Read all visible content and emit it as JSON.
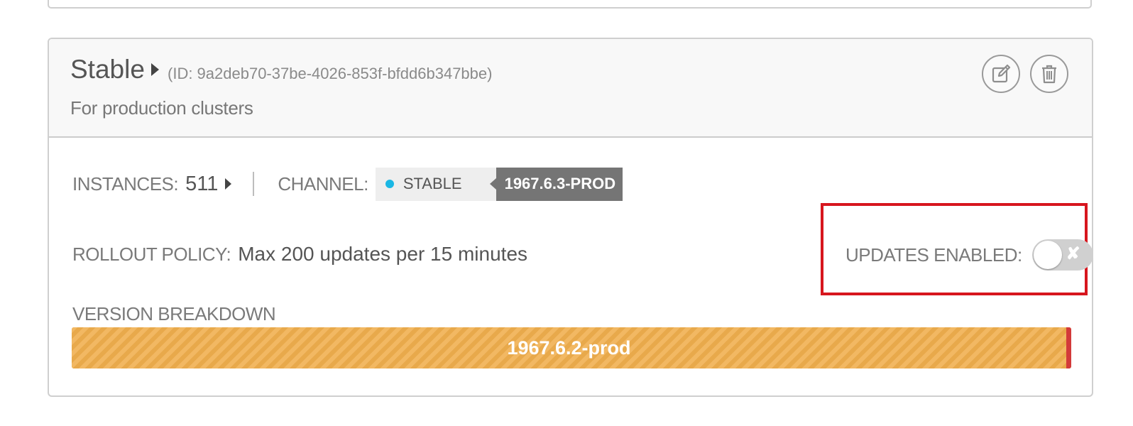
{
  "group": {
    "name": "Stable",
    "id_text": "(ID: 9a2deb70-37be-4026-853f-bfdd6b347bbe)",
    "description": "For production clusters"
  },
  "actions": {
    "edit_icon": "edit-icon",
    "delete_icon": "trash-icon"
  },
  "instances": {
    "label": "INSTANCES:",
    "value": "511"
  },
  "channel": {
    "label": "CHANNEL:",
    "name": "STABLE",
    "version": "1967.6.3-PROD",
    "dot_color": "#1ab7e4"
  },
  "rollout": {
    "label": "ROLLOUT POLICY:",
    "value": "Max 200 updates per 15 minutes"
  },
  "updates": {
    "label": "UPDATES ENABLED:",
    "enabled": false,
    "off_glyph": "✘"
  },
  "version_breakdown": {
    "label": "VERSION BREAKDOWN",
    "segments": [
      {
        "version": "1967.6.2-prod",
        "fraction": 0.995,
        "color": "#f0ae4d"
      },
      {
        "version": "",
        "fraction": 0.005,
        "color": "#d33a3a"
      }
    ]
  },
  "colors": {
    "highlight_border": "#d7161e",
    "version_tag_bg": "#757575"
  }
}
